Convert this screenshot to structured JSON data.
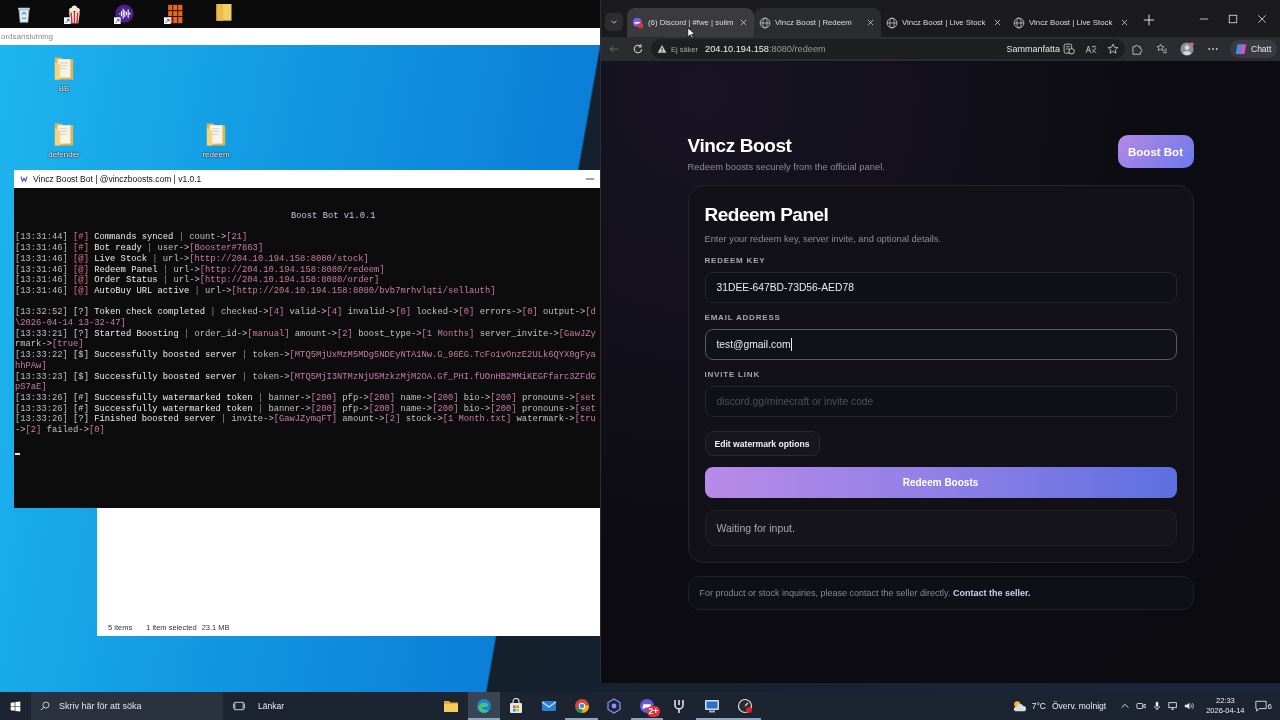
{
  "background_window": {
    "text": "ordsanslutning"
  },
  "desktop": {
    "icons": [
      {
        "label": "BB"
      },
      {
        "label": "defender"
      },
      {
        "label": "redeem"
      }
    ]
  },
  "explorer_window": {
    "status_bar": {
      "items": "5 items",
      "selection": "1 item selected",
      "size": "23.1 MB"
    }
  },
  "console_window": {
    "title": "Vincz Boost Bot | @vinczboosts.com | v1.0.1",
    "heading": "Boost Bot v1.0.1",
    "lines": [
      {
        "kind": "status",
        "time": "[13:31:44]",
        "tag": "[#]",
        "message": "Commands synced",
        "separator": "|",
        "fields": [
          {
            "key": "count->",
            "value": "[21]"
          }
        ]
      },
      {
        "kind": "status",
        "time": "[13:31:46]",
        "tag": "[#]",
        "message": "Bot ready",
        "separator": "|",
        "fields": [
          {
            "key": "user->",
            "value": "[Booster#7863]"
          }
        ]
      },
      {
        "kind": "status",
        "time": "[13:31:46]",
        "tag": "[@]",
        "message": "Live Stock",
        "separator": "|",
        "fields": [
          {
            "key": "url->",
            "value": "[http://204.10.194.158:8080/stock]"
          }
        ]
      },
      {
        "kind": "status",
        "time": "[13:31:46]",
        "tag": "[@]",
        "message": "Redeem Panel",
        "separator": "|",
        "fields": [
          {
            "key": "url->",
            "value": "[http://204.10.194.158:8080/redeem]"
          }
        ]
      },
      {
        "kind": "status",
        "time": "[13:31:46]",
        "tag": "[@]",
        "message": "Order Status",
        "separator": "|",
        "fields": [
          {
            "key": "url->",
            "value": "[http://204.10.194.158:8080/order]"
          }
        ]
      },
      {
        "kind": "status",
        "time": "[13:31:46]",
        "tag": "[@]",
        "message": "AutoBuy URL active",
        "separator": "|",
        "fields": [
          {
            "key": "url->",
            "value": "[http://204.10.194.158:8080/bvb7mrhvlqti/sellauth]"
          }
        ]
      },
      {
        "kind": "blank"
      },
      {
        "kind": "event",
        "time": "[13:32:52]",
        "tag": "[?]",
        "message": "Token check completed",
        "separator": "|",
        "fields": [
          {
            "key": "checked->",
            "value": "[4]"
          },
          {
            "key": "valid->",
            "value": "[4]"
          },
          {
            "key": "invalid->",
            "value": "[0]"
          },
          {
            "key": "locked->",
            "value": "[0]"
          },
          {
            "key": "errors->",
            "value": "[0]"
          },
          {
            "key": "output->",
            "value": "[d"
          }
        ]
      },
      {
        "kind": "wrap",
        "fields": [
          {
            "value": "\\2026-04-14 13-32-47]"
          }
        ]
      },
      {
        "kind": "event",
        "time": "[13:33:21]",
        "tag": "[?]",
        "message": "Started Boosting",
        "separator": "|",
        "fields": [
          {
            "key": "order_id->",
            "value": "[manual]"
          },
          {
            "key": "amount->",
            "value": "[2]"
          },
          {
            "key": "boost_type->",
            "value": "[1 Months]"
          },
          {
            "key": "server_invite->",
            "value": "[GawJZy"
          }
        ]
      },
      {
        "kind": "wrap",
        "fields": [
          {
            "key": "rmark->",
            "value": "[true]"
          }
        ]
      },
      {
        "kind": "event",
        "time": "[13:33:22]",
        "tag": "[$]",
        "message": "Successfully boosted server",
        "separator": "|",
        "fields": [
          {
            "key": "token->",
            "value": "[MTQ5MjUxMzM5MDg5NDEyNTA1Nw.G_96EG.TcFo1vOnzE2ULk6QYX0gFya"
          }
        ]
      },
      {
        "kind": "wrap",
        "fields": [
          {
            "value": "hhPAw]"
          }
        ]
      },
      {
        "kind": "event",
        "time": "[13:33:23]",
        "tag": "[$]",
        "message": "Successfully boosted server",
        "separator": "|",
        "fields": [
          {
            "key": "token->",
            "value": "[MTQ5MjI3NTMzNjU5MzkzMjM2OA.Gf_PHI.fUOnHB2MMiKEGFfarc3ZFdG"
          }
        ]
      },
      {
        "kind": "wrap",
        "fields": [
          {
            "value": "pS7aE]"
          }
        ]
      },
      {
        "kind": "event",
        "time": "[13:33:26]",
        "tag": "[#]",
        "message": "Successfully watermarked token",
        "separator": "|",
        "fields": [
          {
            "key": "banner->",
            "value": "[200]"
          },
          {
            "key": "pfp->",
            "value": "[200]"
          },
          {
            "key": "name->",
            "value": "[200]"
          },
          {
            "key": "bio->",
            "value": "[200]"
          },
          {
            "key": "pronouns->",
            "value": "[set"
          }
        ]
      },
      {
        "kind": "event",
        "time": "[13:33:26]",
        "tag": "[#]",
        "message": "Successfully watermarked token",
        "separator": "|",
        "fields": [
          {
            "key": "banner->",
            "value": "[200]"
          },
          {
            "key": "pfp->",
            "value": "[200]"
          },
          {
            "key": "name->",
            "value": "[200]"
          },
          {
            "key": "bio->",
            "value": "[200]"
          },
          {
            "key": "pronouns->",
            "value": "[set"
          }
        ]
      },
      {
        "kind": "event",
        "time": "[13:33:26]",
        "tag": "[?]",
        "message": "Finished boosted server",
        "separator": "|",
        "fields": [
          {
            "key": "invite->",
            "value": "[GawJZymqFT]"
          },
          {
            "key": "amount->",
            "value": "[2]"
          },
          {
            "key": "stock->",
            "value": "[1 Month.txt]"
          },
          {
            "key": "watermark->",
            "value": "[tru"
          }
        ]
      },
      {
        "kind": "wrap",
        "fields": [
          {
            "key": "->",
            "value": "[2]"
          },
          {
            "key": "failed->",
            "value": "[0]"
          }
        ]
      },
      {
        "kind": "blank"
      },
      {
        "kind": "cursor"
      }
    ]
  },
  "browser": {
    "tabs": [
      {
        "kind": "chat",
        "title": "(6) Discord | #fwe | sulim",
        "selected": false,
        "hovered": true
      },
      {
        "kind": "web",
        "title": "Vincz Boost | Redeem",
        "selected": true,
        "hovered": false
      },
      {
        "kind": "web",
        "title": "Vincz Boost | Live Stock",
        "selected": false,
        "hovered": false
      },
      {
        "kind": "web",
        "title": "Vincz Boost | Live Stock",
        "selected": false,
        "hovered": false
      }
    ],
    "toolbar": {
      "back_enabled": false,
      "security_label": "Ej säker",
      "host": "204.10.194.158",
      "path": ":8080/redeem",
      "summarize_label": "Sammanfatta",
      "bookmarked": false,
      "copilot_label": "Chatt"
    },
    "page": {
      "brand": "Vincz Boost",
      "tagline": "Redeem boosts securely from the official panel.",
      "header_button": "Boost Bot",
      "panel": {
        "title": "Redeem Panel",
        "description": "Enter your redeem key, server invite, and optional details.",
        "fields": [
          {
            "label": "REDEEM KEY",
            "value": "31DEE-647BD-73D56-AED78",
            "focused": false
          },
          {
            "label": "EMAIL ADDRESS",
            "value": "test@gmail.com",
            "focused": true
          },
          {
            "label": "INVITE LINK",
            "placeholder": "discord.gg/minecraft or invite code",
            "focused": false
          }
        ],
        "options_button": "Edit watermark options",
        "submit_button": "Redeem Boosts",
        "status": "Waiting for input."
      },
      "footer": {
        "text": "For product or stock inquiries, please contact the seller directly.",
        "link": "Contact the seller."
      }
    }
  },
  "taskbar": {
    "search_placeholder": "Skriv här för att söka",
    "toolbar_label": "Länkar",
    "apps": [
      {
        "kind": "folder",
        "open": false,
        "selected": false
      },
      {
        "kind": "browser",
        "open": true,
        "selected": true
      },
      {
        "kind": "store",
        "open": false,
        "selected": false
      },
      {
        "kind": "mail",
        "open": false,
        "selected": false
      },
      {
        "kind": "ring",
        "open": true,
        "selected": false
      },
      {
        "kind": "hexagon",
        "open": false,
        "selected": false
      },
      {
        "kind": "controller",
        "open": true,
        "selected": false,
        "badge": "2+"
      },
      {
        "kind": "fork",
        "open": false,
        "selected": false
      },
      {
        "kind": "computer",
        "open": true,
        "selected": false
      },
      {
        "kind": "gauge",
        "open": true,
        "selected": false
      }
    ],
    "weather": {
      "temperature": "7°C",
      "condition": "Överv. molnigt"
    },
    "clock": {
      "time": "22:33",
      "date": "2026-04-14"
    },
    "notification_count": "6"
  }
}
